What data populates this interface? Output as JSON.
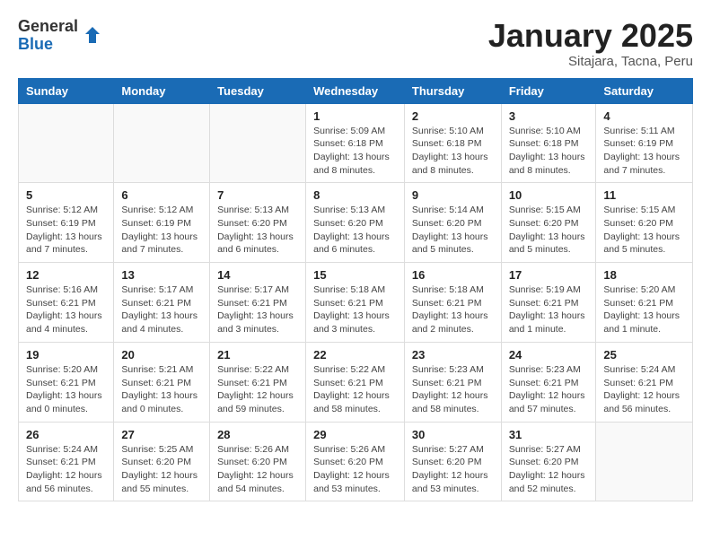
{
  "logo": {
    "general": "General",
    "blue": "Blue"
  },
  "title": "January 2025",
  "location": "Sitajara, Tacna, Peru",
  "days_of_week": [
    "Sunday",
    "Monday",
    "Tuesday",
    "Wednesday",
    "Thursday",
    "Friday",
    "Saturday"
  ],
  "weeks": [
    [
      {
        "day": "",
        "info": ""
      },
      {
        "day": "",
        "info": ""
      },
      {
        "day": "",
        "info": ""
      },
      {
        "day": "1",
        "info": "Sunrise: 5:09 AM\nSunset: 6:18 PM\nDaylight: 13 hours and 8 minutes."
      },
      {
        "day": "2",
        "info": "Sunrise: 5:10 AM\nSunset: 6:18 PM\nDaylight: 13 hours and 8 minutes."
      },
      {
        "day": "3",
        "info": "Sunrise: 5:10 AM\nSunset: 6:18 PM\nDaylight: 13 hours and 8 minutes."
      },
      {
        "day": "4",
        "info": "Sunrise: 5:11 AM\nSunset: 6:19 PM\nDaylight: 13 hours and 7 minutes."
      }
    ],
    [
      {
        "day": "5",
        "info": "Sunrise: 5:12 AM\nSunset: 6:19 PM\nDaylight: 13 hours and 7 minutes."
      },
      {
        "day": "6",
        "info": "Sunrise: 5:12 AM\nSunset: 6:19 PM\nDaylight: 13 hours and 7 minutes."
      },
      {
        "day": "7",
        "info": "Sunrise: 5:13 AM\nSunset: 6:20 PM\nDaylight: 13 hours and 6 minutes."
      },
      {
        "day": "8",
        "info": "Sunrise: 5:13 AM\nSunset: 6:20 PM\nDaylight: 13 hours and 6 minutes."
      },
      {
        "day": "9",
        "info": "Sunrise: 5:14 AM\nSunset: 6:20 PM\nDaylight: 13 hours and 5 minutes."
      },
      {
        "day": "10",
        "info": "Sunrise: 5:15 AM\nSunset: 6:20 PM\nDaylight: 13 hours and 5 minutes."
      },
      {
        "day": "11",
        "info": "Sunrise: 5:15 AM\nSunset: 6:20 PM\nDaylight: 13 hours and 5 minutes."
      }
    ],
    [
      {
        "day": "12",
        "info": "Sunrise: 5:16 AM\nSunset: 6:21 PM\nDaylight: 13 hours and 4 minutes."
      },
      {
        "day": "13",
        "info": "Sunrise: 5:17 AM\nSunset: 6:21 PM\nDaylight: 13 hours and 4 minutes."
      },
      {
        "day": "14",
        "info": "Sunrise: 5:17 AM\nSunset: 6:21 PM\nDaylight: 13 hours and 3 minutes."
      },
      {
        "day": "15",
        "info": "Sunrise: 5:18 AM\nSunset: 6:21 PM\nDaylight: 13 hours and 3 minutes."
      },
      {
        "day": "16",
        "info": "Sunrise: 5:18 AM\nSunset: 6:21 PM\nDaylight: 13 hours and 2 minutes."
      },
      {
        "day": "17",
        "info": "Sunrise: 5:19 AM\nSunset: 6:21 PM\nDaylight: 13 hours and 1 minute."
      },
      {
        "day": "18",
        "info": "Sunrise: 5:20 AM\nSunset: 6:21 PM\nDaylight: 13 hours and 1 minute."
      }
    ],
    [
      {
        "day": "19",
        "info": "Sunrise: 5:20 AM\nSunset: 6:21 PM\nDaylight: 13 hours and 0 minutes."
      },
      {
        "day": "20",
        "info": "Sunrise: 5:21 AM\nSunset: 6:21 PM\nDaylight: 13 hours and 0 minutes."
      },
      {
        "day": "21",
        "info": "Sunrise: 5:22 AM\nSunset: 6:21 PM\nDaylight: 12 hours and 59 minutes."
      },
      {
        "day": "22",
        "info": "Sunrise: 5:22 AM\nSunset: 6:21 PM\nDaylight: 12 hours and 58 minutes."
      },
      {
        "day": "23",
        "info": "Sunrise: 5:23 AM\nSunset: 6:21 PM\nDaylight: 12 hours and 58 minutes."
      },
      {
        "day": "24",
        "info": "Sunrise: 5:23 AM\nSunset: 6:21 PM\nDaylight: 12 hours and 57 minutes."
      },
      {
        "day": "25",
        "info": "Sunrise: 5:24 AM\nSunset: 6:21 PM\nDaylight: 12 hours and 56 minutes."
      }
    ],
    [
      {
        "day": "26",
        "info": "Sunrise: 5:24 AM\nSunset: 6:21 PM\nDaylight: 12 hours and 56 minutes."
      },
      {
        "day": "27",
        "info": "Sunrise: 5:25 AM\nSunset: 6:20 PM\nDaylight: 12 hours and 55 minutes."
      },
      {
        "day": "28",
        "info": "Sunrise: 5:26 AM\nSunset: 6:20 PM\nDaylight: 12 hours and 54 minutes."
      },
      {
        "day": "29",
        "info": "Sunrise: 5:26 AM\nSunset: 6:20 PM\nDaylight: 12 hours and 53 minutes."
      },
      {
        "day": "30",
        "info": "Sunrise: 5:27 AM\nSunset: 6:20 PM\nDaylight: 12 hours and 53 minutes."
      },
      {
        "day": "31",
        "info": "Sunrise: 5:27 AM\nSunset: 6:20 PM\nDaylight: 12 hours and 52 minutes."
      },
      {
        "day": "",
        "info": ""
      }
    ]
  ]
}
